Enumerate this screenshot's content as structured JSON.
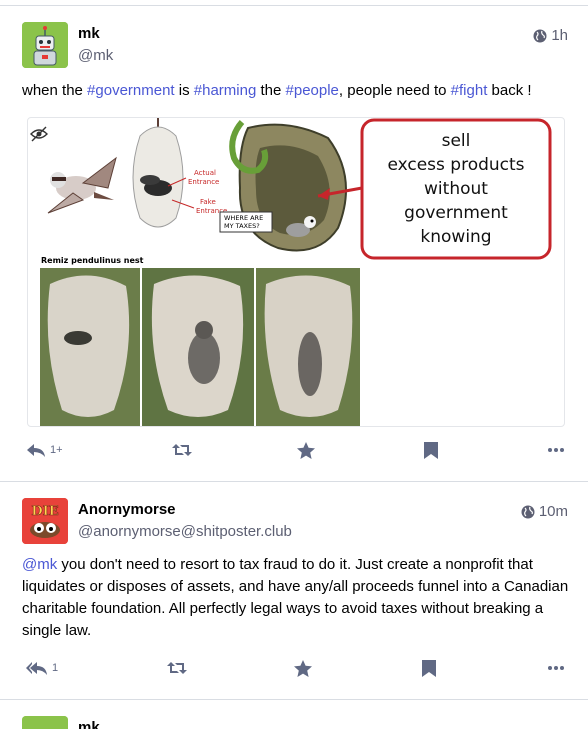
{
  "posts": [
    {
      "display_name": "mk",
      "handle": "@mk",
      "time": "1h",
      "content": {
        "p1": "when the ",
        "t1": "#government",
        "p2": " is ",
        "t2": "#harming",
        "p3": " the ",
        "t3": "#people",
        "p4": ", people need to ",
        "t4": "#fight",
        "p5": " back !"
      },
      "media": {
        "labels": {
          "actual": "Actual",
          "entrance1": "Entrance",
          "fake": "Fake",
          "entrance2": "Entrance",
          "where": "WHERE ARE",
          "taxes": "MY TAXES?",
          "caption": "Remiz pendulinus nest",
          "sell1": "sell",
          "sell2": "excess products",
          "sell3": "without",
          "sell4": "government",
          "sell5": "knowing"
        }
      },
      "actions": {
        "reply_count": "1+"
      }
    },
    {
      "display_name": "Anornymorse",
      "handle": "@anornymorse@shitposter.club",
      "time": "10m",
      "avatar_text": "DIE",
      "content": {
        "mention": "@mk",
        "line1": " you don't need to resort to tax fraud to do it. Just create a nonprofit that",
        "line2": "liquidates or disposes of assets, and have any/all proceeds funnel into a Canadian",
        "line3": "charitable foundation. All perfectly legal ways to avoid taxes without breaking a",
        "line4": "single law."
      },
      "actions": {
        "reply_count": "1"
      }
    },
    {
      "display_name": "mk"
    }
  ],
  "colors": {
    "link": "#4a57d4",
    "muted": "#606984",
    "divider": "#d9dde3",
    "sign_red": "#c6252b"
  },
  "icons": [
    "globe-icon",
    "reply-icon",
    "reply-all-icon",
    "boost-icon",
    "star-icon",
    "bookmark-icon",
    "more-icon",
    "eye-slash-icon"
  ]
}
